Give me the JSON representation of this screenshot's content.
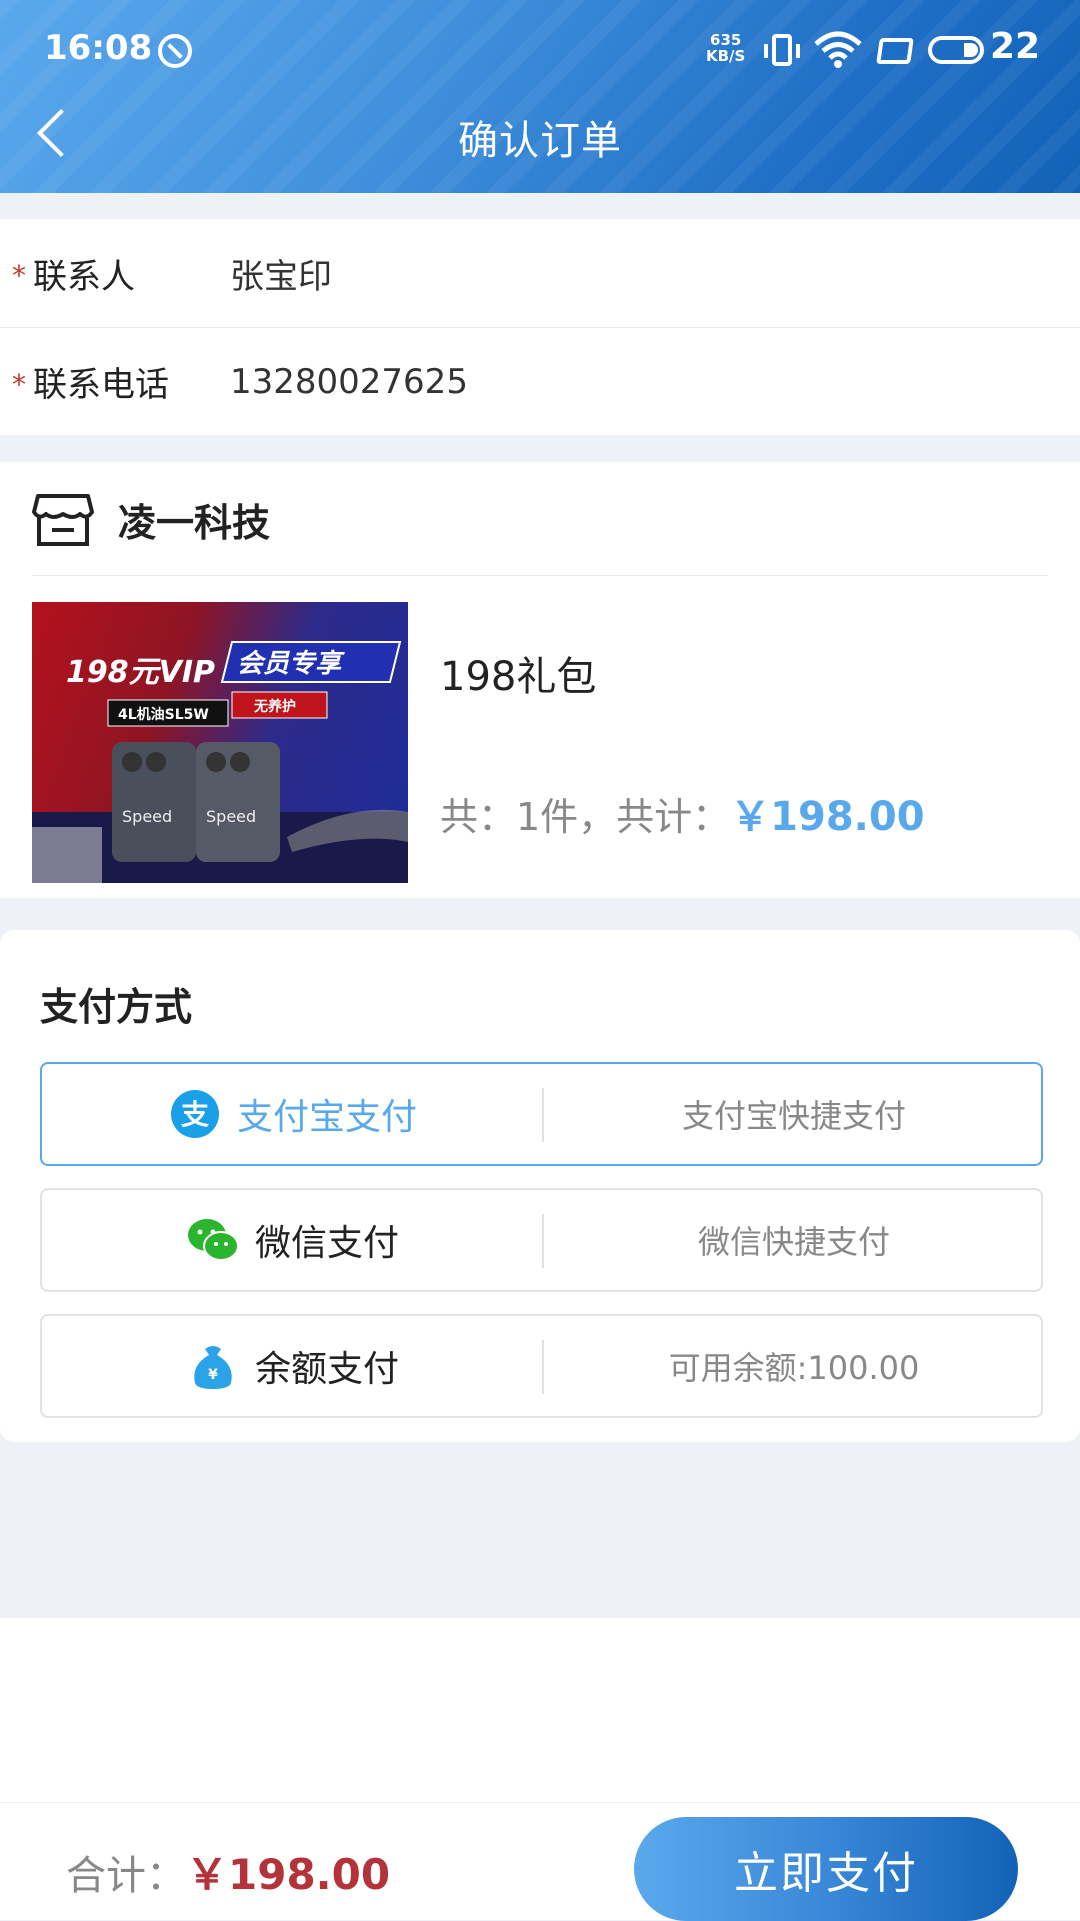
{
  "status_bar": {
    "time": "16:08",
    "net_speed": "635",
    "net_unit": "KB/S",
    "battery": "22"
  },
  "header": {
    "title": "确认订单"
  },
  "contact": {
    "name_label": "联系人",
    "name_value": "张宝印",
    "phone_label": "联系电话",
    "phone_value": "13280027625",
    "required_mark": "*"
  },
  "shop": {
    "name": "凌一科技",
    "product": {
      "name": "198礼包",
      "summary_prefix": "共：1件，共计：",
      "price": "￥198.00",
      "image_text": {
        "headline": "198元VIP",
        "badge": "会员专享",
        "tag1": "4L机油SL5W",
        "tag2": "无养护",
        "brand": "Speed"
      }
    }
  },
  "payment": {
    "title": "支付方式",
    "options": [
      {
        "label": "支付宝支付",
        "desc": "支付宝快捷支付",
        "selected": true,
        "icon": "alipay-icon",
        "color": "#1aa0e8"
      },
      {
        "label": "微信支付",
        "desc": "微信快捷支付",
        "selected": false,
        "icon": "wechat-icon",
        "color": "#2bb52e"
      },
      {
        "label": "余额支付",
        "desc": "可用余额:100.00",
        "selected": false,
        "icon": "money-bag-icon",
        "color": "#2aa3e8"
      }
    ]
  },
  "footer": {
    "total_label": "合计：",
    "total_amount": "￥198.00",
    "pay_button": "立即支付"
  },
  "colors": {
    "primary": "#3f8fdc",
    "accent_blue": "#5aa8ec",
    "price_red": "#b4333a",
    "required": "#c0392b"
  }
}
